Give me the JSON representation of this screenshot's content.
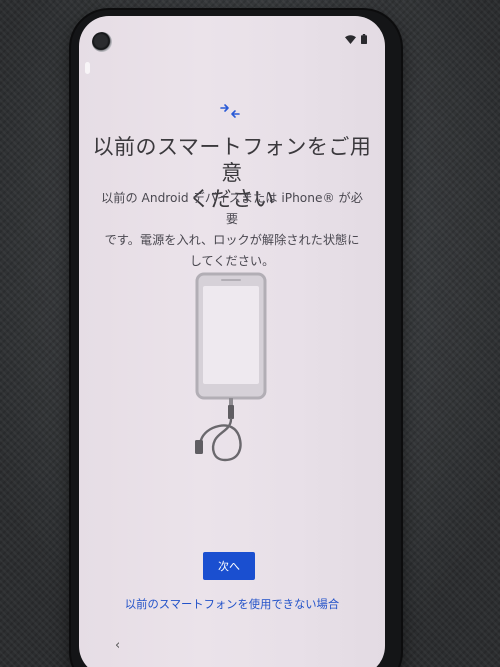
{
  "status_bar": {
    "icons": [
      "wifi-icon",
      "battery-icon"
    ]
  },
  "header": {
    "icon": "transfer-arrows-icon",
    "title_line1": "以前のスマートフォンをご用意",
    "title_line2": "ください"
  },
  "body": {
    "line1": "以前の Android デバイスまたは iPhone® が必要",
    "line2": "です。電源を入れ、ロックが解除された状態に",
    "line3": "してください。",
    "illustration": "phone-with-cable-icon"
  },
  "actions": {
    "next_label": "次へ",
    "alt_link": "以前のスマートフォンを使用できない場合"
  },
  "nav": {
    "back_label": "‹"
  },
  "colors": {
    "accent": "#1a4fd0",
    "link": "#2252c9",
    "background": "#e8e0e8",
    "text": "#3b393d"
  }
}
